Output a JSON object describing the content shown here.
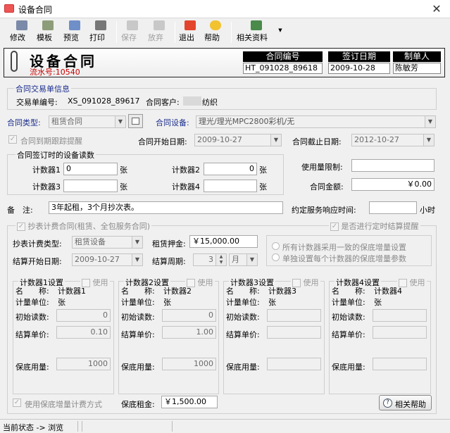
{
  "window": {
    "title": "设备合同",
    "close_glyph": "✕"
  },
  "toolbar": {
    "edit": "修改",
    "template": "模板",
    "preview": "预览",
    "print": "打印",
    "save": "保存",
    "discard": "放弃",
    "exit": "退出",
    "help": "帮助",
    "related": "相关资料",
    "related_arrow": "▼"
  },
  "header": {
    "title": "设备合同",
    "serial_label": "流水号:",
    "serial_value": "10540",
    "contract_no_label": "合同编号",
    "contract_no": "HT_091028_89618",
    "sign_date_label": "签订日期",
    "sign_date": "2009-10-28",
    "maker_label": "制单人",
    "maker": "陈敏芳"
  },
  "trade": {
    "group_title": "合同交易单信息",
    "order_no_label": "交易单编号:",
    "order_no": "XS_091028_89617",
    "customer_label": "合同客户:",
    "customer": "纺织"
  },
  "form": {
    "type_label": "合同类型:",
    "type_value": "租赁合同",
    "device_label": "合同设备:",
    "device_value": "理光/理光MPC2800彩机/无",
    "track_label": "合同到期跟踪提醒",
    "start_label": "合同开始日期:",
    "start_value": "2009-10-27",
    "end_label": "合同截止日期:",
    "end_value": "2012-10-27"
  },
  "readings": {
    "group_title": "合同签订时的设备读数",
    "c1_label": "计数器1",
    "c1_value": "0",
    "c1_unit": "张",
    "c2_label": "计数器2",
    "c2_value": "0",
    "c2_unit": "张",
    "c3_label": "计数器3",
    "c3_value": "",
    "c3_unit": "张",
    "c4_label": "计数器4",
    "c4_value": "",
    "c4_unit": "张"
  },
  "usage": {
    "limit_label": "使用量限制:",
    "limit_value": "",
    "amount_label": "合同金额:",
    "amount_value": "￥0.00"
  },
  "notes": {
    "label": "备　注:",
    "value": "3年起租，3个月抄次表。",
    "response_label": "约定服务响应时间:",
    "response_value": "",
    "response_unit": "小时"
  },
  "billing": {
    "group_title": "抄表计费合同(租赁、全包服务合同)",
    "timed_label": "是否进行定时结算提醒",
    "type_label": "抄表计费类型:",
    "type_value": "租赁设备",
    "deposit_label": "租赁押金:",
    "deposit_value": "￥15,000.00",
    "start_label": "结算开始日期:",
    "start_value": "2009-10-27",
    "period_label": "结算周期:",
    "period_value": "3",
    "period_unit": "月",
    "radio1": "所有计数器采用一致的保底增量设置",
    "radio2": "单独设置每个计数器的保底增量参数"
  },
  "counters": [
    {
      "title": "计数器1设置",
      "use": "使用",
      "name_label": "名　　称:",
      "name": "计数器1",
      "unit_label": "计量单位:",
      "unit": "张",
      "init_label": "初始读数:",
      "init": "0",
      "price_label": "结算单价:",
      "price": "0.10",
      "min_label": "保底用量:",
      "min": "1000"
    },
    {
      "title": "计数器2设置",
      "use": "使用",
      "name_label": "名　　称:",
      "name": "计数器2",
      "unit_label": "计量单位:",
      "unit": "张",
      "init_label": "初始读数:",
      "init": "0",
      "price_label": "结算单价:",
      "price": "1.00",
      "min_label": "保底用量:",
      "min": "1000"
    },
    {
      "title": "计数器3设置",
      "use": "使用",
      "name_label": "名　　称:",
      "name": "计数器3",
      "unit_label": "计量单位:",
      "unit": "张",
      "init_label": "初始读数:",
      "init": "",
      "price_label": "结算单价:",
      "price": "",
      "min_label": "保底用量:",
      "min": ""
    },
    {
      "title": "计数器4设置",
      "use": "使用",
      "name_label": "名　　称:",
      "name": "计数器4",
      "unit_label": "计量单位:",
      "unit": "张",
      "init_label": "初始读数:",
      "init": "",
      "price_label": "结算单价:",
      "price": "",
      "min_label": "保底用量:",
      "min": ""
    }
  ],
  "footer": {
    "use_min_label": "使用保底增量计费方式",
    "min_rent_label": "保底租金:",
    "min_rent_value": "￥1,500.00",
    "help_button": "相关帮助",
    "status": "当前状态 -> 浏览"
  },
  "colors": {
    "accent_blue": "#1a2d8c",
    "serial_red": "#cc0000"
  }
}
